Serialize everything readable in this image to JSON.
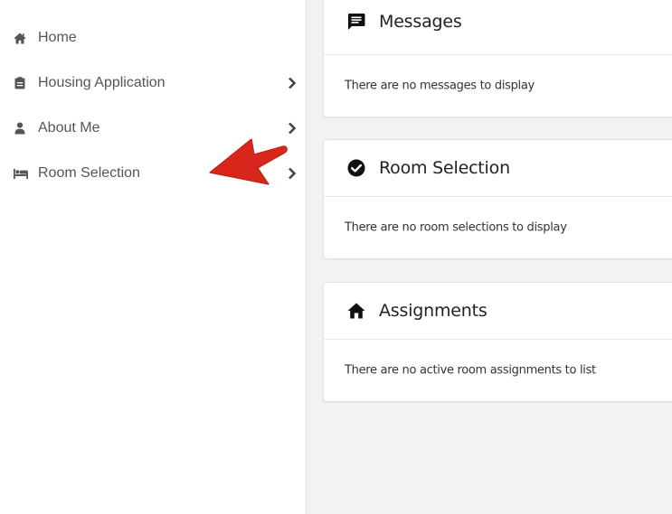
{
  "sidebar": {
    "items": [
      {
        "label": "Home",
        "icon": "home-icon",
        "has_chevron": false
      },
      {
        "label": "Housing Application",
        "icon": "clipboard-icon",
        "has_chevron": true
      },
      {
        "label": "About Me",
        "icon": "user-icon",
        "has_chevron": true
      },
      {
        "label": "Room Selection",
        "icon": "bed-icon",
        "has_chevron": true
      }
    ]
  },
  "main": {
    "cards": [
      {
        "title": "Messages",
        "icon": "message-icon",
        "body": "There are no messages to display"
      },
      {
        "title": "Room Selection",
        "icon": "check-circle-icon",
        "body": "There are no room selections to display"
      },
      {
        "title": "Assignments",
        "icon": "home-icon",
        "body": "There are no active room assignments to list"
      }
    ]
  },
  "colors": {
    "annotation_arrow": "#d9261c",
    "sidebar_text": "#555555",
    "main_background": "#f2f2f2",
    "card_background": "#ffffff"
  }
}
